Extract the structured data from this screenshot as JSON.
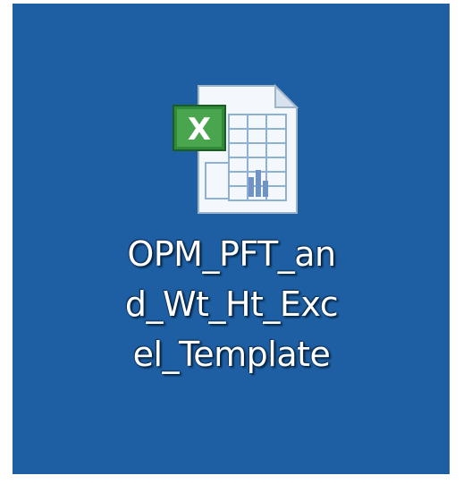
{
  "desktop": {
    "background_color": "#1e5fa3",
    "icon": {
      "type_icon": "excel-file-icon",
      "badge_letter": "X",
      "label_lines": [
        "OPM_PFT_an",
        "d_Wt_Ht_Exc",
        "el_Template"
      ]
    }
  }
}
